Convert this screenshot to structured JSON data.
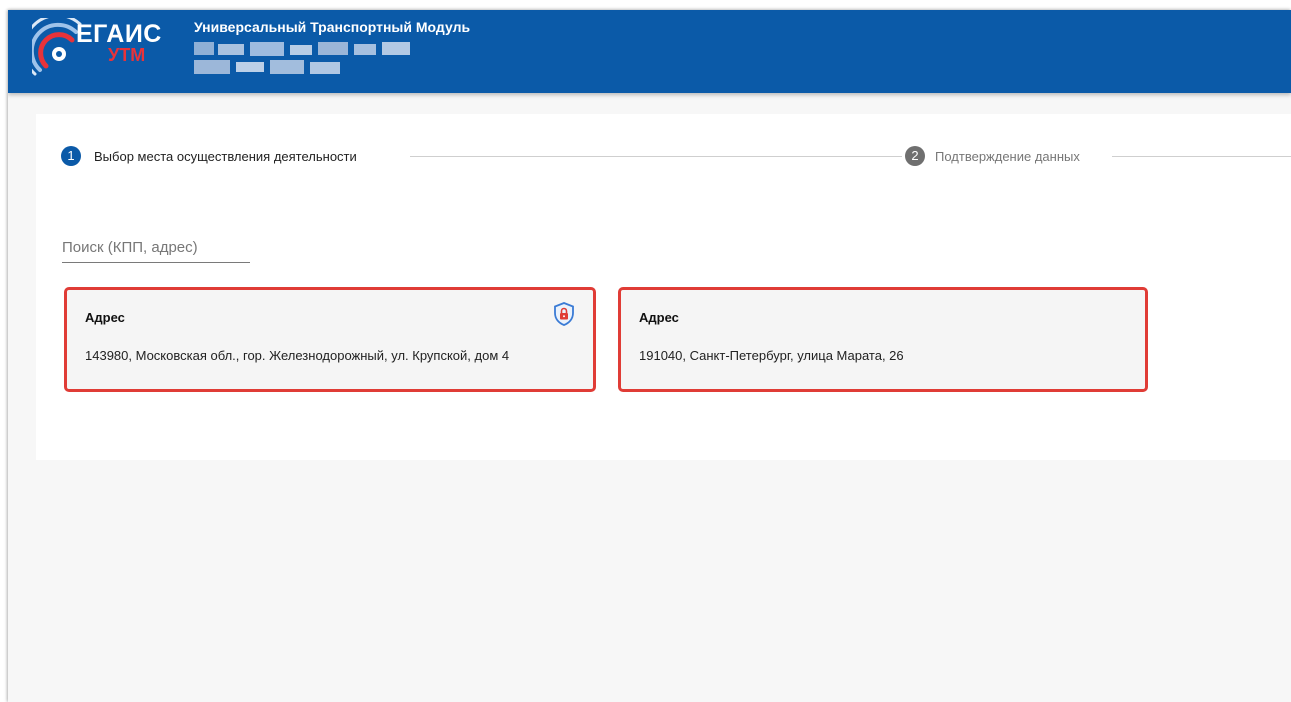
{
  "header": {
    "logo": {
      "egais": "ЕГАИС",
      "utm": "УТМ"
    },
    "title": "Универсальный Транспортный Модуль"
  },
  "stepper": {
    "steps": [
      {
        "number": "1",
        "label": "Выбор места осуществления деятельности",
        "state": "active"
      },
      {
        "number": "2",
        "label": "Подтверждение данных",
        "state": "inactive"
      }
    ]
  },
  "search": {
    "placeholder": "Поиск (КПП, адрес)",
    "value": ""
  },
  "cards": [
    {
      "title": "Адрес",
      "address": "143980, Московская обл., гор. Железнодорожный, ул. Крупской, дом 4",
      "icon": "shield-lock-icon"
    },
    {
      "title": "Адрес",
      "address": "191040, Санкт-Петербург, улица Марата, 26"
    }
  ],
  "colors": {
    "header_bg": "#0b5aa8",
    "step_active": "#0b5aa8",
    "step_inactive": "#7a7a7a",
    "highlight_border": "#e03c36",
    "icon_shield": "#3a7bd5",
    "icon_lock": "#e03c36"
  }
}
